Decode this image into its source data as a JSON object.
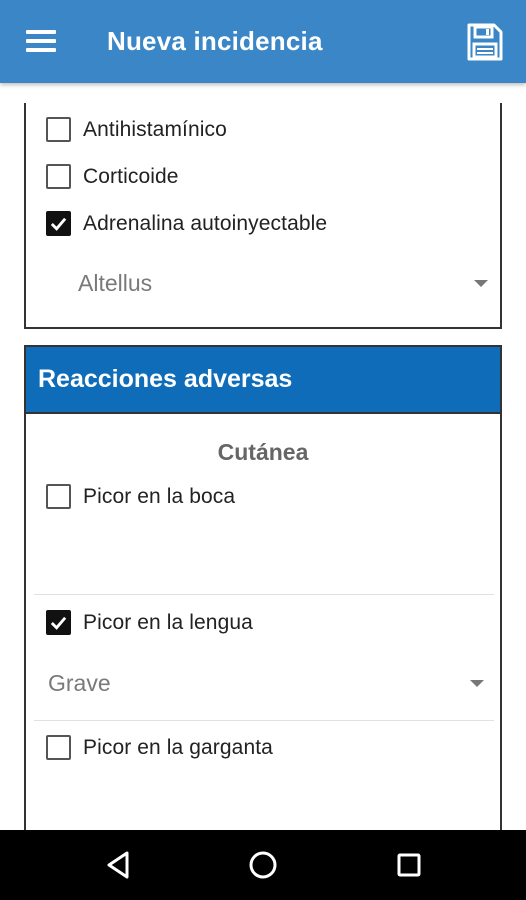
{
  "appbar": {
    "title": "Nueva incidencia",
    "menu_icon": "hamburger-menu-icon",
    "save_icon": "floppy-disk-save-icon",
    "background": "#3a86c6"
  },
  "medication": {
    "items": [
      {
        "label": "Antihistamínico",
        "checked": false
      },
      {
        "label": "Corticoide",
        "checked": false
      },
      {
        "label": "Adrenalina autoinyectable",
        "checked": true
      }
    ],
    "brand_select": {
      "value": "Altellus"
    }
  },
  "reactions": {
    "title": "Reacciones adversas",
    "header_color": "#0e6cb9",
    "category": "Cutánea",
    "items": [
      {
        "label": "Picor en la boca",
        "checked": false
      },
      {
        "label": "Picor en la lengua",
        "checked": true,
        "severity": "Grave"
      },
      {
        "label": "Picor en la garganta",
        "checked": false
      }
    ]
  },
  "navbar": {
    "back_icon": "back-triangle-icon",
    "home_icon": "home-circle-icon",
    "recents_icon": "recents-square-icon"
  }
}
